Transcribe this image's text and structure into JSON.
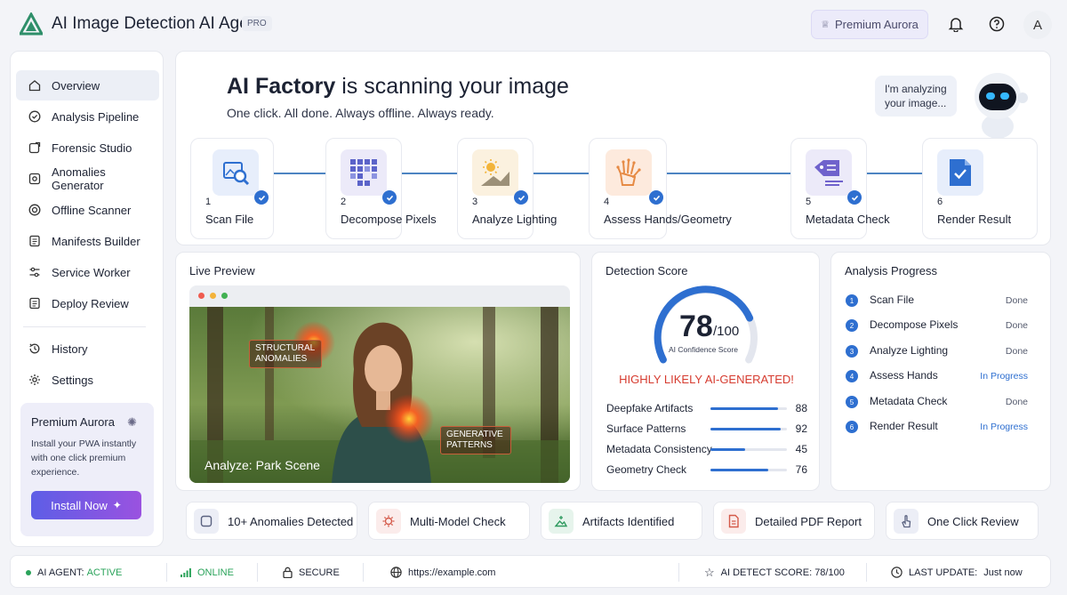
{
  "header": {
    "title": "AI Image Detection AI Agent",
    "badge": "PRO",
    "premium_button": "Premium Aurora",
    "avatar_letter": "A"
  },
  "sidebar": {
    "items": [
      {
        "label": "Overview",
        "icon": "home-icon",
        "active": true
      },
      {
        "label": "Analysis Pipeline",
        "icon": "check-circle-icon"
      },
      {
        "label": "Forensic Studio",
        "icon": "external-square-icon"
      },
      {
        "label": "Anomalies Generator",
        "icon": "gear-square-icon"
      },
      {
        "label": "Offline Scanner",
        "icon": "target-icon"
      },
      {
        "label": "Manifests Builder",
        "icon": "document-icon"
      },
      {
        "label": "Service Worker",
        "icon": "sliders-icon"
      },
      {
        "label": "Deploy Review",
        "icon": "document-icon"
      },
      {
        "label": "History",
        "icon": "history-icon"
      },
      {
        "label": "Settings",
        "icon": "gear-icon"
      }
    ],
    "promo": {
      "title": "Premium Aurora",
      "text": "Install your PWA instantly with one click premium experience.",
      "button": "Install Now"
    }
  },
  "hero": {
    "title_bold": "AI Factory",
    "title_rest": " is scanning your image",
    "subtitle": "One click. All done. Always offline. Always ready.",
    "bubble": "I'm analyzing your image...",
    "steps": [
      {
        "num": "1",
        "label": "Scan File",
        "icon": "image-search-icon"
      },
      {
        "num": "2",
        "label": "Decompose Pixels",
        "icon": "pixel-grid-icon"
      },
      {
        "num": "3",
        "label": "Analyze Lighting",
        "icon": "sun-landscape-icon"
      },
      {
        "num": "4",
        "label": "Assess Hands/Geometry",
        "icon": "hand-wireframe-icon"
      },
      {
        "num": "5",
        "label": "Metadata Check",
        "icon": "tag-list-icon"
      },
      {
        "num": "6",
        "label": "Render Result",
        "icon": "document-check-icon"
      }
    ]
  },
  "preview": {
    "title": "Live Preview",
    "annotation_1": "Structural Anomalies",
    "annotation_2": "Generative Patterns",
    "caption": "Analyze: Park Scene"
  },
  "detection": {
    "title": "Detection Score",
    "score": "78",
    "denominator": "/100",
    "score_fraction": 0.78,
    "caption": "AI Confidence Score",
    "verdict": "HIGHLY LIKELY AI-GENERATED!",
    "metrics": [
      {
        "label": "Deepfake Artifacts",
        "value": "88"
      },
      {
        "label": "Surface Patterns",
        "value": "92"
      },
      {
        "label": "Metadata Consistency",
        "value": "45"
      },
      {
        "label": "Geometry Check",
        "value": "76"
      }
    ]
  },
  "progress": {
    "title": "Analysis Progress",
    "rows": [
      {
        "num": "1",
        "label": "Scan File",
        "status": "Done"
      },
      {
        "num": "2",
        "label": "Decompose Pixels",
        "status": "Done"
      },
      {
        "num": "3",
        "label": "Analyze Lighting",
        "status": "Done"
      },
      {
        "num": "4",
        "label": "Assess Hands",
        "status": "In Progress"
      },
      {
        "num": "5",
        "label": "Metadata Check",
        "status": "Done"
      },
      {
        "num": "6",
        "label": "Render Result",
        "status": "In Progress"
      }
    ]
  },
  "features": [
    {
      "label": "10+ Anomalies Detected",
      "icon": "cube-icon"
    },
    {
      "label": "Multi-Model Check",
      "icon": "chip-icon"
    },
    {
      "label": "Artifacts Identified",
      "icon": "image-icon"
    },
    {
      "label": "Detailed PDF Report",
      "icon": "pdf-icon"
    },
    {
      "label": "One Click Review",
      "icon": "pointer-hand-icon"
    }
  ],
  "statusbar": {
    "agent_label": "AI AGENT:",
    "agent_value": "ACTIVE",
    "online": "ONLINE",
    "secure": "SECURE",
    "url": "https://example.com",
    "score_label": "AI DETECT SCORE: 78/100",
    "update_label": "LAST UPDATE:",
    "update_value": "Just now"
  },
  "colors": {
    "accent": "#2e6fd0",
    "alert": "#d63b2f",
    "online": "#2aa35a"
  }
}
